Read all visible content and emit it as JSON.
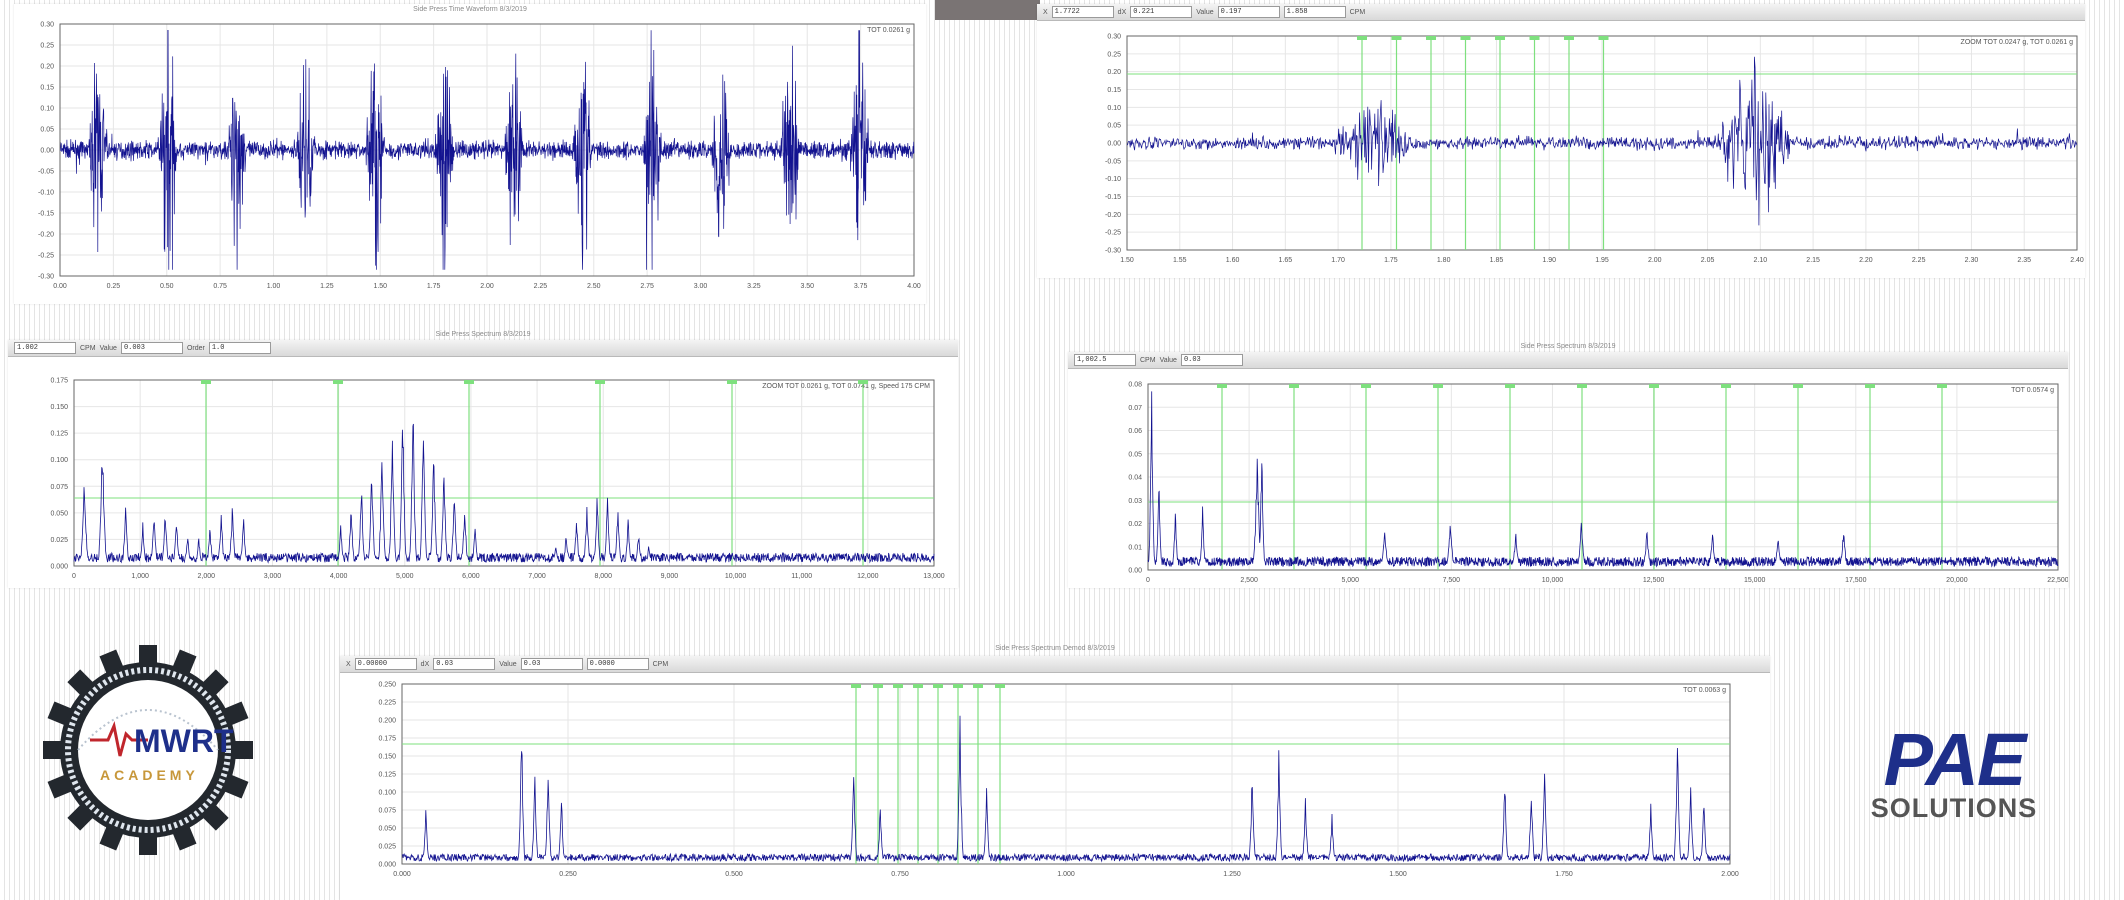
{
  "colors": {
    "signal": "#131390",
    "marker": "#7ee07e",
    "grid": "#e6e6e6",
    "axis": "#666666",
    "logo_blue": "#1e2f8a",
    "logo_red": "#c0262c",
    "logo_gray": "#555555",
    "gear": "#23282e",
    "gold": "#c7973a"
  },
  "icons": {
    "mwrt_logo": "gear-logo-icon",
    "pae_logo": "pae-logo-icon"
  },
  "logos": {
    "mwrt": "MWRT",
    "mwrt_sub": "ACADEMY",
    "pae": "PAE",
    "pae_sub": "SOLUTIONS"
  },
  "charts": {
    "tl": {
      "title": "Side Press Time Waveform 8/3/2019",
      "total": "TOT 0.0261 g",
      "y_ticks": [
        "0.30",
        "0.25",
        "0.20",
        "0.15",
        "0.10",
        "0.05",
        "0.00",
        "-0.05",
        "-0.10",
        "-0.15",
        "-0.20",
        "-0.25",
        "-0.30"
      ],
      "x_ticks": [
        "0.00",
        "0.25",
        "0.50",
        "0.75",
        "1.00",
        "1.25",
        "1.50",
        "1.75",
        "2.00",
        "2.25",
        "2.50",
        "2.75",
        "3.00",
        "3.25",
        "3.50",
        "3.75",
        "4.00"
      ]
    },
    "tr": {
      "toolbar": [
        "1.7722",
        "0.221",
        "Value",
        "0.197",
        "1.858",
        "CPM"
      ],
      "total": "ZOOM TOT 0.0247 g, TOT 0.0261 g",
      "y_ticks": [
        "0.30",
        "0.25",
        "0.20",
        "0.15",
        "0.10",
        "0.05",
        "0.00",
        "-0.05",
        "-0.10",
        "-0.15",
        "-0.20",
        "-0.25",
        "-0.30"
      ],
      "x_ticks": [
        "1.50",
        "1.55",
        "1.60",
        "1.65",
        "1.70",
        "1.75",
        "1.80",
        "1.85",
        "1.90",
        "1.95",
        "2.00",
        "2.05",
        "2.10",
        "2.15",
        "2.20",
        "2.25",
        "2.30",
        "2.35",
        "2.40"
      ]
    },
    "ml": {
      "title": "Side Press Spectrum 8/3/2019",
      "toolbar": [
        "1.002",
        "CPM",
        "Value",
        "0.003",
        "Order",
        "1.0"
      ],
      "total": "ZOOM TOT 0.0261 g, TOT 0.0741 g, Speed 175 CPM",
      "y_ticks": [
        "0.175",
        "0.150",
        "0.125",
        "0.100",
        "0.075",
        "0.050",
        "0.025",
        "0.000"
      ],
      "x_ticks": [
        "0",
        "1,000",
        "2,000",
        "3,000",
        "4,000",
        "5,000",
        "6,000",
        "7,000",
        "8,000",
        "9,000",
        "10,000",
        "11,000",
        "12,000",
        "13,000"
      ]
    },
    "mr": {
      "title": "Side Press Spectrum 8/3/2019",
      "toolbar": [
        "1,002.5",
        "CPM",
        "Value",
        "0.03"
      ],
      "total": "TOT 0.0574 g",
      "y_ticks": [
        "0.08",
        "0.07",
        "0.06",
        "0.05",
        "0.04",
        "0.03",
        "0.02",
        "0.01",
        "0.00"
      ],
      "x_ticks": [
        "0",
        "2,500",
        "5,000",
        "7,500",
        "10,000",
        "12,500",
        "15,000",
        "17,500",
        "20,000",
        "22,500"
      ]
    },
    "bot": {
      "title": "Side Press Spectrum Demod 8/3/2019",
      "toolbar": [
        "0.00000",
        "0.03",
        "Value",
        "0.03",
        "0.0000",
        "CPM"
      ],
      "total": "TOT 0.0063 g",
      "y_ticks": [
        "0.250",
        "0.225",
        "0.200",
        "0.175",
        "0.150",
        "0.125",
        "0.100",
        "0.075",
        "0.050",
        "0.025",
        "0.000"
      ],
      "x_ticks": [
        "0.000",
        "0.250",
        "0.500",
        "0.750",
        "1.000",
        "1.250",
        "1.500",
        "1.750",
        "2.000"
      ]
    }
  }
}
